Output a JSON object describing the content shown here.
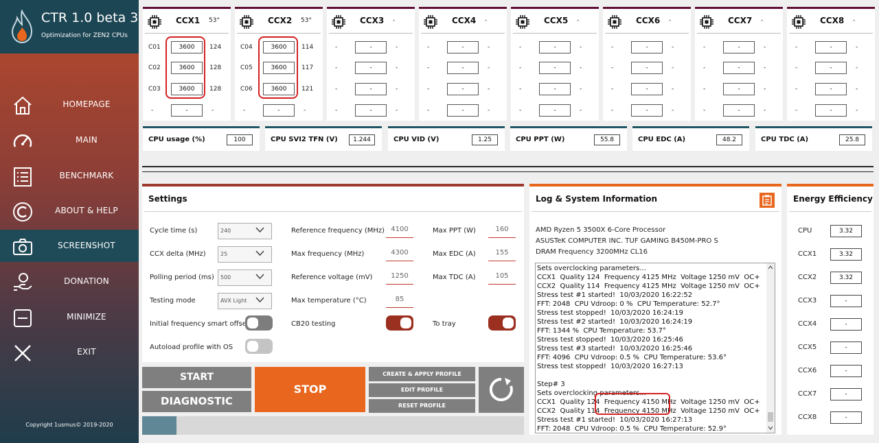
{
  "app": {
    "title": "CTR 1.0 beta 3",
    "subtitle": "Optimization for ZEN2 CPUs",
    "copyright": "Copyright 1usmus© 2019-2020"
  },
  "nav": [
    {
      "label": "HOMEPAGE",
      "icon": "home-icon"
    },
    {
      "label": "MAIN",
      "icon": "speedometer-icon"
    },
    {
      "label": "BENCHMARK",
      "icon": "checklist-icon"
    },
    {
      "label": "ABOUT & HELP",
      "icon": "copyright-icon"
    },
    {
      "label": "SCREENSHOT",
      "icon": "camera-icon"
    },
    {
      "label": "DONATION",
      "icon": "donation-icon"
    },
    {
      "label": "MINIMIZE",
      "icon": "minimize-icon"
    },
    {
      "label": "EXIT",
      "icon": "exit-icon"
    }
  ],
  "ccx": [
    {
      "name": "CCX1",
      "temp": "53°",
      "cores": [
        {
          "label": "C01",
          "freq": "3600",
          "val": "124"
        },
        {
          "label": "C02",
          "freq": "3600",
          "val": "128"
        },
        {
          "label": "C03",
          "freq": "3600",
          "val": "128"
        },
        {
          "label": "-",
          "freq": "-",
          "val": "-"
        }
      ]
    },
    {
      "name": "CCX2",
      "temp": "53°",
      "cores": [
        {
          "label": "C04",
          "freq": "3600",
          "val": "114"
        },
        {
          "label": "C05",
          "freq": "3600",
          "val": "117"
        },
        {
          "label": "C06",
          "freq": "3600",
          "val": "121"
        },
        {
          "label": "-",
          "freq": "-",
          "val": "-"
        }
      ]
    },
    {
      "name": "CCX3",
      "temp": "-",
      "cores": [
        {
          "label": "-",
          "freq": "-",
          "val": "-"
        },
        {
          "label": "-",
          "freq": "-",
          "val": "-"
        },
        {
          "label": "-",
          "freq": "-",
          "val": "-"
        },
        {
          "label": "-",
          "freq": "-",
          "val": "-"
        }
      ]
    },
    {
      "name": "CCX4",
      "temp": "-",
      "cores": [
        {
          "label": "-",
          "freq": "-",
          "val": "-"
        },
        {
          "label": "-",
          "freq": "-",
          "val": "-"
        },
        {
          "label": "-",
          "freq": "-",
          "val": "-"
        },
        {
          "label": "-",
          "freq": "-",
          "val": "-"
        }
      ]
    },
    {
      "name": "CCX5",
      "temp": "-",
      "cores": [
        {
          "label": "-",
          "freq": "-",
          "val": "-"
        },
        {
          "label": "-",
          "freq": "-",
          "val": "-"
        },
        {
          "label": "-",
          "freq": "-",
          "val": "-"
        },
        {
          "label": "-",
          "freq": "-",
          "val": "-"
        }
      ]
    },
    {
      "name": "CCX6",
      "temp": "-",
      "cores": [
        {
          "label": "-",
          "freq": "-",
          "val": "-"
        },
        {
          "label": "-",
          "freq": "-",
          "val": "-"
        },
        {
          "label": "-",
          "freq": "-",
          "val": "-"
        },
        {
          "label": "-",
          "freq": "-",
          "val": "-"
        }
      ]
    },
    {
      "name": "CCX7",
      "temp": "-",
      "cores": [
        {
          "label": "-",
          "freq": "-",
          "val": "-"
        },
        {
          "label": "-",
          "freq": "-",
          "val": "-"
        },
        {
          "label": "-",
          "freq": "-",
          "val": "-"
        },
        {
          "label": "-",
          "freq": "-",
          "val": "-"
        }
      ]
    },
    {
      "name": "CCX8",
      "temp": "-",
      "cores": [
        {
          "label": "-",
          "freq": "-",
          "val": "-"
        },
        {
          "label": "-",
          "freq": "-",
          "val": "-"
        },
        {
          "label": "-",
          "freq": "-",
          "val": "-"
        },
        {
          "label": "-",
          "freq": "-",
          "val": "-"
        }
      ]
    }
  ],
  "metrics": [
    {
      "label": "CPU usage (%)",
      "value": "100"
    },
    {
      "label": "CPU SVI2 TFN (V)",
      "value": "1.244"
    },
    {
      "label": "CPU VID (V)",
      "value": "1.25"
    },
    {
      "label": "CPU PPT (W)",
      "value": "55.8"
    },
    {
      "label": "CPU EDC (A)",
      "value": "48.2"
    },
    {
      "label": "CPU TDC (A)",
      "value": "25.8"
    }
  ],
  "settings": {
    "title": "Settings",
    "cycle_time": {
      "label": "Cycle time (s)",
      "value": "240"
    },
    "ccx_delta": {
      "label": "CCX delta (MHz)",
      "value": "25"
    },
    "polling": {
      "label": "Polling period (ms)",
      "value": "500"
    },
    "testing_mode": {
      "label": "Testing mode",
      "value": "AVX Light"
    },
    "ref_freq": {
      "label": "Reference frequency (MHz)",
      "value": "4100"
    },
    "max_freq": {
      "label": "Max frequency (MHz)",
      "value": "4300"
    },
    "ref_volt": {
      "label": "Reference voltage (mV)",
      "value": "1250"
    },
    "max_temp": {
      "label": "Max temperature (°C)",
      "value": "85"
    },
    "max_ppt": {
      "label": "Max PPT (W)",
      "value": "160"
    },
    "max_edc": {
      "label": "Max EDC (A)",
      "value": "155"
    },
    "max_tdc": {
      "label": "Max TDC (A)",
      "value": "105"
    },
    "smart_offset": {
      "label": "Initial frequency smart offset",
      "on": false
    },
    "cb20": {
      "label": "CB20 testing",
      "on": true
    },
    "to_tray": {
      "label": "To tray",
      "on": true
    },
    "autoload": {
      "label": "Autoload profile with OS",
      "on": false
    }
  },
  "buttons": {
    "start": "START",
    "diagnostic": "DIAGNOSTIC",
    "stop": "STOP",
    "create_profile": "CREATE & APPLY PROFILE",
    "edit_profile": "EDIT PROFILE",
    "reset_profile": "RESET PROFILE"
  },
  "progress": {
    "fraction": 0.09
  },
  "log": {
    "title": "Log & System Information",
    "cpu": "AMD Ryzen 5 3500X 6-Core Processor",
    "board": "ASUSTeK COMPUTER INC. TUF GAMING B450M-PRO S",
    "dram": "DRAM Frequency 3200MHz CL16",
    "lines": [
      "Sets overclocking parameters...",
      "CCX1  Quality 124  Frequency 4125 MHz  Voltage 1250 mV  OC+",
      "CCX2  Quality 114  Frequency 4125 MHz  Voltage 1250 mV  OC+",
      "Stress test #1 started!  10/03/2020 16:22:52",
      "FFT: 2048  CPU Vdroop: 0 %  CPU Temperature: 52.7°",
      "Stress test stopped!  10/03/2020 16:24:19",
      "Stress test #2 started!  10/03/2020 16:24:19",
      "FFT: 1344 %  CPU Temperature: 53.7°",
      "Stress test stopped!  10/03/2020 16:25:46",
      "Stress test #3 started!  10/03/2020 16:25:46",
      "FFT: 4096  CPU Vdroop: 0.5 %  CPU Temperature: 53.6°",
      "Stress test stopped!  10/03/2020 16:27:13",
      "",
      "Step# 3",
      "Sets overclocking parameters...",
      "CCX1  Quality 124  Frequency 4150 MHz  Voltage 1250 mV  OC+",
      "CCX2  Quality 114  Frequency 4150 MHz  Voltage 1250 mV  OC+",
      "Stress test #1 started!  10/03/2020 16:27:13",
      "FFT: 2048  CPU Vdroop: 0.5 %  CPU Temperature: 52.9°"
    ]
  },
  "energy": {
    "title": "Energy Efficiency",
    "rows": [
      {
        "label": "CPU",
        "value": "3.32"
      },
      {
        "label": "CCX1",
        "value": "3.32"
      },
      {
        "label": "CCX2",
        "value": "3.32"
      },
      {
        "label": "CCX3",
        "value": "-"
      },
      {
        "label": "CCX4",
        "value": "-"
      },
      {
        "label": "CCX5",
        "value": "-"
      },
      {
        "label": "CCX6",
        "value": "-"
      },
      {
        "label": "CCX7",
        "value": "-"
      },
      {
        "label": "CCX8",
        "value": "-"
      }
    ]
  },
  "colors": {
    "accent": "#e8661e",
    "button_gray": "#7f7f7f",
    "dark_teal": "#1d4654",
    "maroon": "#5e0f34",
    "toggle_on": "#9b3020"
  }
}
